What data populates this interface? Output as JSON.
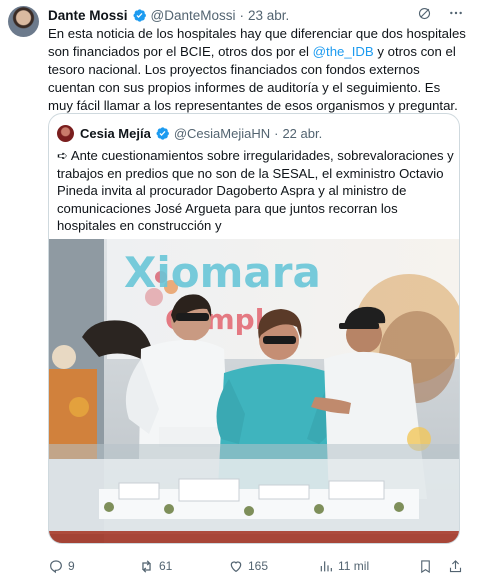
{
  "tweet": {
    "author_name": "Dante Mossi",
    "author_handle": "@DanteMossi",
    "separator": "·",
    "date": "23 abr.",
    "text_before": "En esta noticia de los hospitales hay que diferenciar que dos hospitales son financiados por el BCIE, otros dos por el ",
    "mention": "@the_IDB",
    "text_after": " y otros con el tesoro nacional. Los proyectos financiados con fondos externos cuentan con sus propios informes de auditoría y el seguimiento. Es muy fácil llamar a los representantes de esos organismos y preguntar."
  },
  "quote": {
    "author_name": "Cesia Mejía",
    "author_handle": "@CesiaMejiaHN",
    "separator": "·",
    "date": "22 abr.",
    "text": "➪ Ante cuestionamientos sobre irregularidades, sobrevaloraciones y trabajos en predios que no son de la SESAL, el exministro Octavio Pineda invita al procurador Dagoberto Aspra y al ministro de comunicaciones José Argueta para que juntos recorran los hospitales en construcción y",
    "photo": {
      "banner_line1": "Xiomara",
      "banner_line2": "Cumple"
    }
  },
  "actions": {
    "replies": "9",
    "reposts": "61",
    "likes": "165",
    "views": "11 mil"
  },
  "icons": {
    "verified": "verified-badge-icon",
    "grok": "grok-icon",
    "more": "more-icon",
    "reply": "reply-icon",
    "repost": "repost-icon",
    "like": "like-icon",
    "views": "views-icon",
    "bookmark": "bookmark-icon",
    "share": "share-icon"
  },
  "colors": {
    "accent": "#1d9bf0",
    "text": "#0f1419",
    "muted": "#536471",
    "border": "#cfd9de"
  }
}
